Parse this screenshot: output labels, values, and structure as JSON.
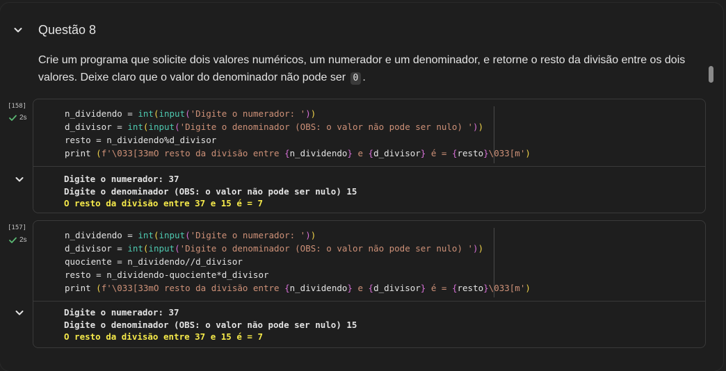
{
  "section": {
    "title": "Questão 8",
    "description_before": "Crie um programa que solicite dois valores numéricos, um numerador e um denominador, e retorne o resto da divisão entre os dois valores. Deixe claro que o valor do denominador não pode ser ",
    "description_code": "0",
    "description_after": "."
  },
  "cells": [
    {
      "exec_count": "[158]",
      "exec_time": "2s",
      "code_lines": [
        "n_dividendo = int(input('Digite o numerador: '))",
        "d_divisor = int(input('Digite o denominador (OBS: o valor não pode ser nulo) '))",
        "resto = n_dividendo%d_divisor",
        "print (f'\\033[33mO resto da divisão entre {n_dividendo} e {d_divisor} é = {resto}\\033[m')"
      ],
      "output_lines": [
        "Digite o numerador: 37",
        "Digite o denominador (OBS: o valor não pode ser nulo) 15",
        "O resto da divisão entre 37 e 15 é = 7"
      ]
    },
    {
      "exec_count": "[157]",
      "exec_time": "2s",
      "code_lines": [
        "n_dividendo = int(input('Digite o numerador: '))",
        "d_divisor = int(input('Digite o denominador (OBS: o valor não pode ser nulo) '))",
        "quociente = n_dividendo//d_divisor",
        "resto = n_dividendo-quociente*d_divisor",
        "print (f'\\033[33mO resto da divisão entre {n_dividendo} e {d_divisor} é = {resto}\\033[m')"
      ],
      "output_lines": [
        "Digite o numerador: 37",
        "Digite o denominador (OBS: o valor não pode ser nulo) 15",
        "O resto da divisão entre 37 e 15 é = 7"
      ]
    }
  ],
  "icons": {
    "section_toggle": "chevron-down-icon",
    "output_toggle": "chevron-down-icon",
    "status": "check-icon"
  },
  "colors": {
    "success": "#5bb974",
    "ansi_yellow": "#f5e94a"
  }
}
